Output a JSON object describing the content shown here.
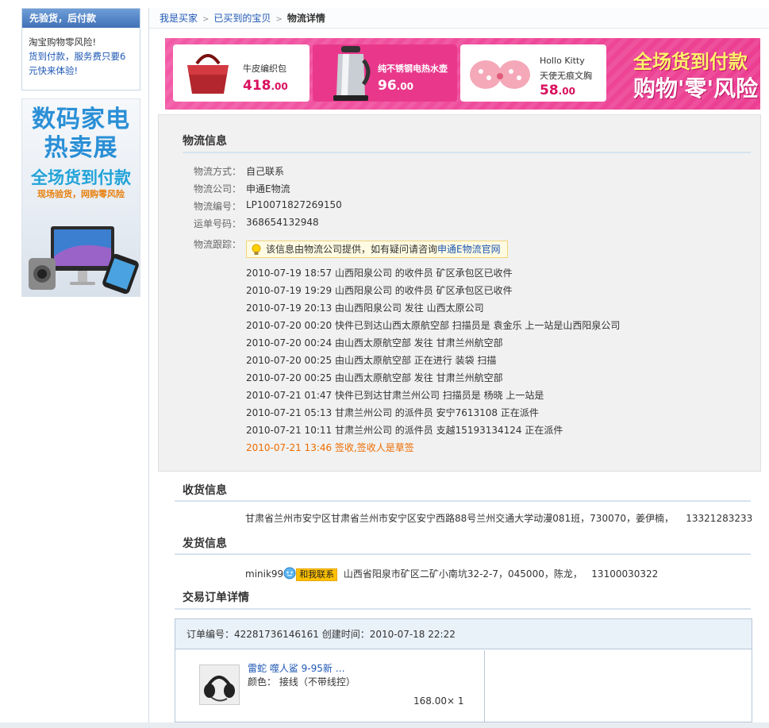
{
  "left": {
    "promo_head": "先验货，后付款",
    "promo_line1": "淘宝购物零风险!",
    "promo_line2": "货到付款，服务费只要6元快来体验!",
    "ad_title1": "数码家电",
    "ad_title2": "热卖展",
    "ad_title3": "全场货到付款",
    "ad_title4": "现场验货，网购零风险"
  },
  "breadcrumb": {
    "item1": "我是买家",
    "item2": "已买到的宝贝",
    "current": "物流详情"
  },
  "banner": {
    "p1_name": "牛皮编织包",
    "p1_price": "418",
    "p1_cents": ".00",
    "p2_name": "纯不锈钢电热水壶",
    "p2_price": "96",
    "p2_cents": ".00",
    "p3_name": "Hollo Kitty",
    "p3_name2": "天使无痕文胸",
    "p3_price": "58",
    "p3_cents": ".00",
    "slogan1": "全场货到付款",
    "slogan2": "购物'零'风险"
  },
  "logistics": {
    "title": "物流信息",
    "method_label": "物流方式：",
    "method": "自己联系",
    "company_label": "物流公司：",
    "company": "申通E物流",
    "code_label": "物流编号：",
    "code": "LP10071827269150",
    "waybill_label": "运单号码：",
    "waybill": "368654132948",
    "track_label": "物流跟踪：",
    "hint_text": "该信息由物流公司提供，如有疑问请咨询",
    "hint_link": "申通E物流官网",
    "tracks": [
      "2010-07-19 18:57 山西阳泉公司 的收件员 矿区承包区已收件",
      "2010-07-19 19:29 山西阳泉公司 的收件员 矿区承包区已收件",
      "2010-07-19 20:13 由山西阳泉公司 发往 山西太原公司",
      "2010-07-20 00:20 快件已到达山西太原航空部 扫描员是 袁金乐 上一站是山西阳泉公司",
      "2010-07-20 00:24 由山西太原航空部 发往 甘肃兰州航空部",
      "2010-07-20 00:25 由山西太原航空部 正在进行 装袋 扫描",
      "2010-07-20 00:25 由山西太原航空部 发往 甘肃兰州航空部",
      "2010-07-21 01:47 快件已到达甘肃兰州公司 扫描员是 杨晓 上一站是",
      "2010-07-21 05:13 甘肃兰州公司 的派件员 安宁7613108 正在派件",
      "2010-07-21 10:11 甘肃兰州公司 的派件员 支越15193134124 正在派件",
      "2010-07-21 13:46 签收,签收人是草签"
    ]
  },
  "receive": {
    "title": "收货信息",
    "address": "甘肃省兰州市安宁区甘肃省兰州市安宁区安宁西路88号兰州交通大学动漫081班，730070，姜伊楠，",
    "phone": "13321283233"
  },
  "send": {
    "title": "发货信息",
    "seller": "minik99",
    "contact_label": "和我联系",
    "address": "山西省阳泉市矿区二矿小南坑32-2-7，045000，陈龙，",
    "phone": "13100030322"
  },
  "order": {
    "title": "交易订单详情",
    "head": "订单编号：42281736146161   创建时间：2010-07-18 22:22",
    "item_name": "雷蛇 噬人鲨 9-95新 …",
    "item_attr": "颜色：  接线（不带线控）",
    "item_price": "168.00× 1"
  }
}
